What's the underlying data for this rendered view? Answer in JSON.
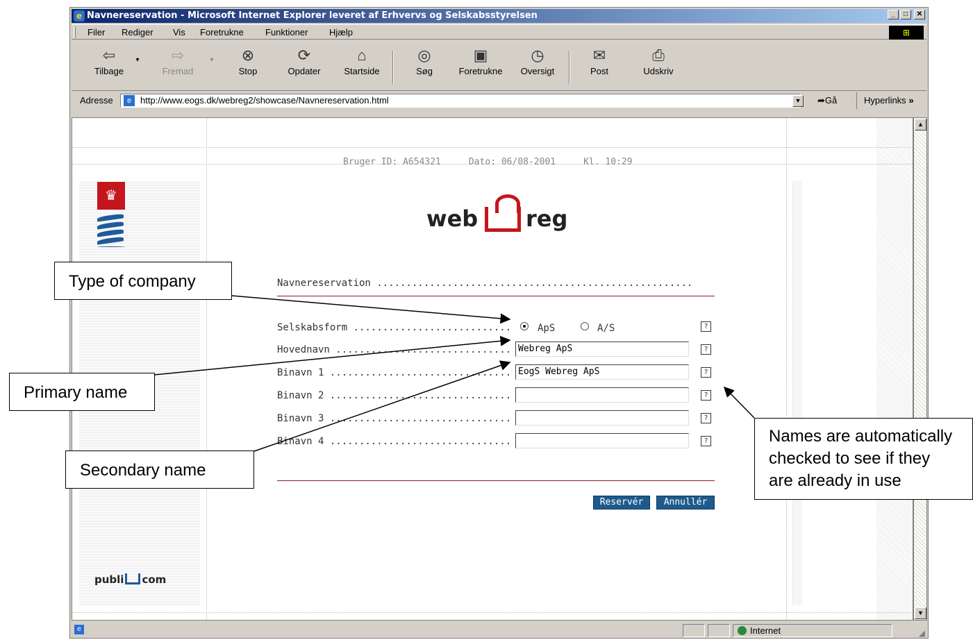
{
  "window": {
    "title": "Navnereservation - Microsoft Internet Explorer leveret af Erhvervs og Selskabsstyrelsen"
  },
  "menu": [
    "Filer",
    "Rediger",
    "Vis",
    "Foretrukne",
    "Funktioner",
    "Hjælp"
  ],
  "toolbar": {
    "back": "Tilbage",
    "forward": "Fremad",
    "stop": "Stop",
    "refresh": "Opdater",
    "home": "Startside",
    "search": "Søg",
    "favorites": "Foretrukne",
    "history": "Oversigt",
    "mail": "Post",
    "print": "Udskriv"
  },
  "address": {
    "label": "Adresse",
    "url": "http://www.eogs.dk/webreg2/showcase/Navnereservation.html",
    "go": "Gå",
    "links": "Hyperlinks"
  },
  "page": {
    "user_id": "Bruger ID: A654321",
    "date": "Dato: 06/08-2001",
    "time": "Kl. 10:29",
    "logo_left": "web",
    "logo_right": "reg",
    "section_title": "Navnereservation ...............................................................",
    "form": {
      "company_type_label": "Selskabsform ..............................",
      "option_aps": "ApS",
      "option_as": "A/S",
      "main_name_label": "Hovednavn .................................................",
      "main_name_value": "Webreg ApS",
      "secondary1_label": "Binavn 1 ...............................................",
      "secondary1_value": "EogS Webreg ApS",
      "secondary2_label": "Binavn 2 ...............................................",
      "secondary3_label": "Binavn 3 ...............................................",
      "secondary4_label": "Binavn 4 ...............................................",
      "help": "?"
    },
    "reserve_button": "Reservér",
    "cancel_button": "Annullér",
    "publicom_left": "publi",
    "publicom_right": "com"
  },
  "status": {
    "zone": "Internet"
  },
  "callouts": {
    "type_of_company": "Type of company",
    "primary_name": "Primary name",
    "secondary_name": "Secondary name",
    "auto_check_1": "Names are automatically",
    "auto_check_2": "checked to see if they",
    "auto_check_3": "are already in use"
  },
  "colors": {
    "title_bar": "#0a246a",
    "brand_red": "#c4161c",
    "button_blue": "#1e5b8c",
    "divider": "#8b1a2b"
  }
}
